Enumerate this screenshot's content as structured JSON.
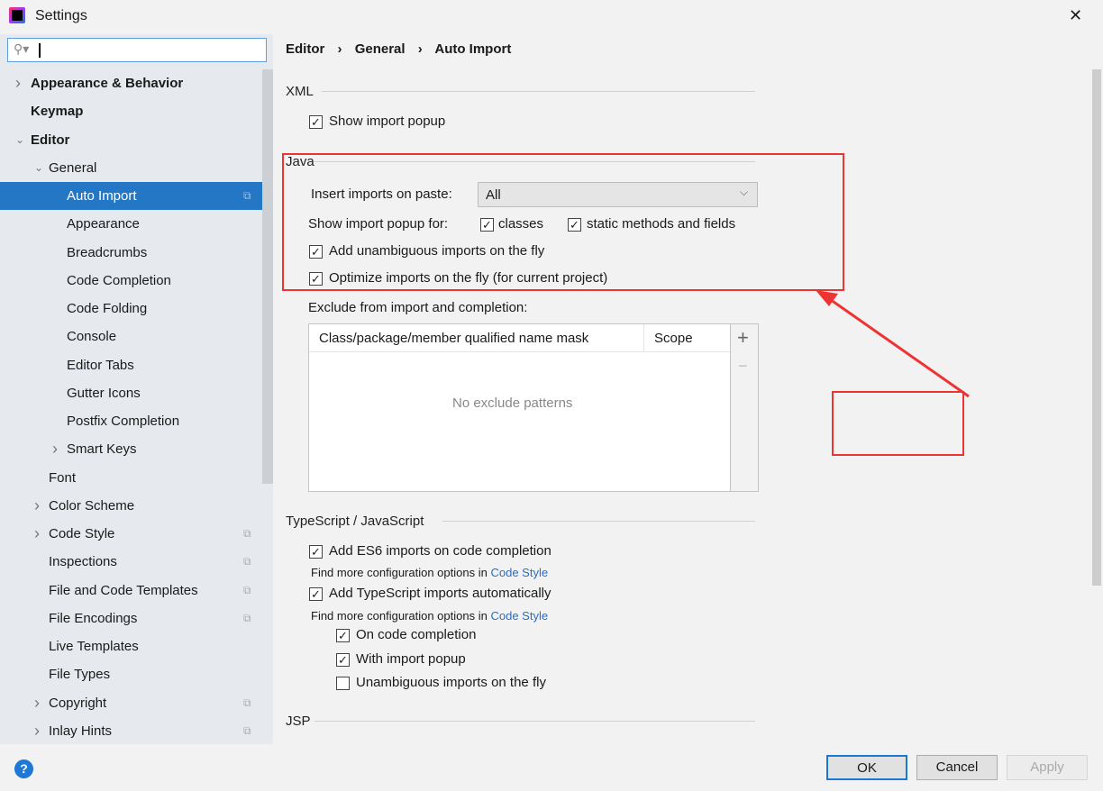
{
  "window": {
    "title": "Settings",
    "close": "✕"
  },
  "search": {
    "value": "",
    "placeholder": ""
  },
  "sidebar": {
    "items": [
      {
        "label": "Appearance & Behavior",
        "level": 0,
        "arrow": "right",
        "bold": true
      },
      {
        "label": "Keymap",
        "level": 0,
        "bold": true
      },
      {
        "label": "Editor",
        "level": 0,
        "arrow": "down",
        "bold": true
      },
      {
        "label": "General",
        "level": 1,
        "arrow": "down"
      },
      {
        "label": "Auto Import",
        "level": 2,
        "selected": true,
        "copy": true
      },
      {
        "label": "Appearance",
        "level": 2
      },
      {
        "label": "Breadcrumbs",
        "level": 2
      },
      {
        "label": "Code Completion",
        "level": 2
      },
      {
        "label": "Code Folding",
        "level": 2
      },
      {
        "label": "Console",
        "level": 2
      },
      {
        "label": "Editor Tabs",
        "level": 2
      },
      {
        "label": "Gutter Icons",
        "level": 2
      },
      {
        "label": "Postfix Completion",
        "level": 2
      },
      {
        "label": "Smart Keys",
        "level": 2,
        "arrow": "right"
      },
      {
        "label": "Font",
        "level": 1
      },
      {
        "label": "Color Scheme",
        "level": 1,
        "arrow": "right"
      },
      {
        "label": "Code Style",
        "level": 1,
        "arrow": "right",
        "copy": true
      },
      {
        "label": "Inspections",
        "level": 1,
        "copy": true
      },
      {
        "label": "File and Code Templates",
        "level": 1,
        "copy": true
      },
      {
        "label": "File Encodings",
        "level": 1,
        "copy": true
      },
      {
        "label": "Live Templates",
        "level": 1
      },
      {
        "label": "File Types",
        "level": 1
      },
      {
        "label": "Copyright",
        "level": 1,
        "arrow": "right",
        "copy": true
      },
      {
        "label": "Inlay Hints",
        "level": 1,
        "arrow": "right",
        "copy": true
      }
    ]
  },
  "breadcrumb": {
    "items": [
      "Editor",
      "General",
      "Auto Import"
    ],
    "separator": "›"
  },
  "xml": {
    "title": "XML",
    "show_popup": "Show import popup"
  },
  "java": {
    "title": "Java",
    "insert_label": "Insert imports on paste:",
    "insert_value": "All",
    "popup_label": "Show import popup for:",
    "classes": "classes",
    "static": "static methods and fields",
    "unambiguous": "Add unambiguous imports on the fly",
    "optimize": "Optimize imports on the fly (for current project)",
    "exclude_label": "Exclude from import and completion:",
    "col_mask": "Class/package/member qualified name mask",
    "col_scope": "Scope",
    "empty": "No exclude patterns",
    "add": "+",
    "remove": "−"
  },
  "ts": {
    "title": "TypeScript / JavaScript",
    "es6": "Add ES6 imports on code completion",
    "find_more": "Find more configuration options in",
    "code_style": "Code Style",
    "ts_auto": "Add TypeScript imports automatically",
    "on_completion": "On code completion",
    "with_popup": "With import popup",
    "unambiguous": "Unambiguous imports on the fly"
  },
  "jsp": {
    "title": "JSP"
  },
  "buttons": {
    "help": "?",
    "ok": "OK",
    "cancel": "Cancel",
    "apply": "Apply"
  },
  "colors": {
    "selection": "#2477c5",
    "annotation": "#ee3333",
    "link": "#2a6dc4"
  }
}
